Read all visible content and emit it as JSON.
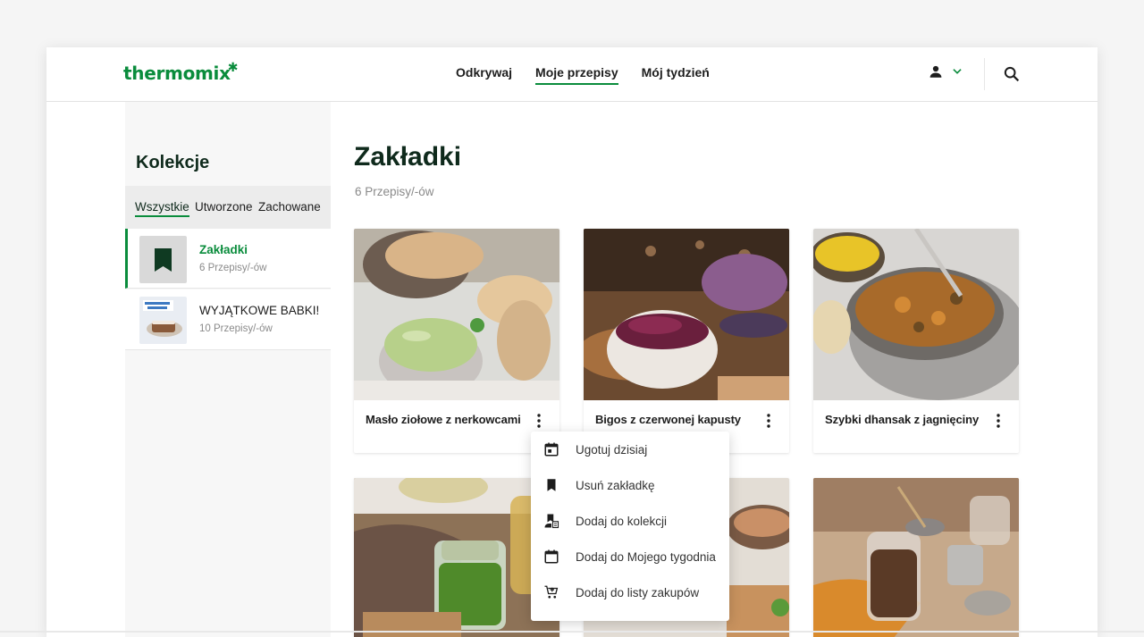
{
  "header": {
    "logo_text": "thermomix",
    "nav": [
      "Odkrywaj",
      "Moje przepisy",
      "Mój tydzień"
    ],
    "active_nav": "Moje przepisy"
  },
  "sidebar": {
    "title": "Kolekcje",
    "filters": [
      "Wszystkie",
      "Utworzone",
      "Zachowane"
    ],
    "active_filter": "Wszystkie",
    "collections": [
      {
        "name": "Zakładki",
        "count": "6 Przepisy/-ów",
        "active": true,
        "thumb_icon": "bookmark-icon"
      },
      {
        "name": "WYJĄTKOWE BABKI!",
        "count": "10 Przepisy/-ów",
        "active": false,
        "thumb_icon": "cake-photo"
      }
    ]
  },
  "main": {
    "title": "Zakładki",
    "count": "6 Przepisy/-ów",
    "recipes": [
      {
        "title": "Masło ziołowe z nerkowcami"
      },
      {
        "title": "Bigos z czerwonej kapusty"
      },
      {
        "title": "Szybki dhansak z jagnięciny"
      },
      {
        "title": ""
      },
      {
        "title": ""
      },
      {
        "title": ""
      }
    ]
  },
  "context_menu": {
    "items": [
      {
        "label": "Ugotuj dzisiaj",
        "icon": "calendar-today-icon"
      },
      {
        "label": "Usuń zakładkę",
        "icon": "bookmark-icon"
      },
      {
        "label": "Dodaj do kolekcji",
        "icon": "add-to-collection-icon"
      },
      {
        "label": "Dodaj do Mojego tygodnia",
        "icon": "calendar-icon"
      },
      {
        "label": "Dodaj do listy zakupów",
        "icon": "cart-add-icon"
      }
    ]
  },
  "colors": {
    "brand_green": "#0a8c3c",
    "dark_heading": "#0f2a1c",
    "muted_text": "#8a8a8a"
  }
}
